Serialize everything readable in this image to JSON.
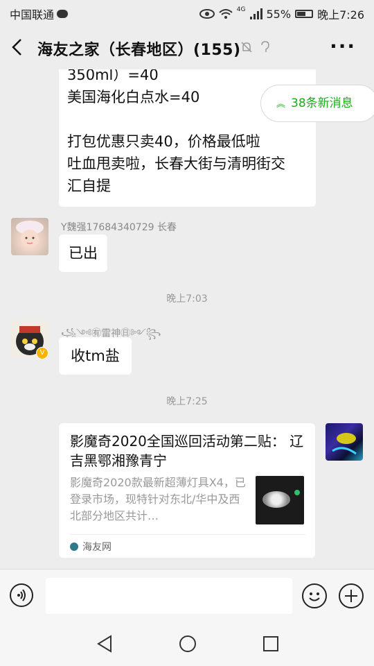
{
  "status_bar": {
    "carrier": "中国联通",
    "battery": "55%",
    "time": "晚上7:26",
    "network": "4G"
  },
  "header": {
    "title": "海友之家（长春地区）(155)",
    "back_icon": "chevron-left-icon",
    "more_label": "···"
  },
  "new_messages": {
    "label": "38条新消息"
  },
  "messages": {
    "m1": {
      "text": "350ml）=40\n美国海化白点水=40\n\n打包优惠只卖40，价格最低啦\n吐血甩卖啦，长春大街与清明街交\n汇自提"
    },
    "m2": {
      "sender": "Y魏强17684340729 长春",
      "text": "已出"
    },
    "time1": "晚上7:03",
    "m3": {
      "sender": "꧁༺㊒雷神㊐༻꧂",
      "text": "收tm盐"
    },
    "time2": "晚上7:25",
    "m4": {
      "title": "影魔奇2020全国巡回活动第二贴： 辽吉黑鄂湘豫青宁",
      "description": "影魔奇2020款最新超薄灯具X4，已登录市场，现特针对东北/华中及西北部分地区共计…",
      "source": "海友网"
    }
  },
  "colors": {
    "background": "#ededed",
    "accent_green": "#1aad19",
    "bubble": "#ffffff",
    "meta_gray": "#999999"
  }
}
